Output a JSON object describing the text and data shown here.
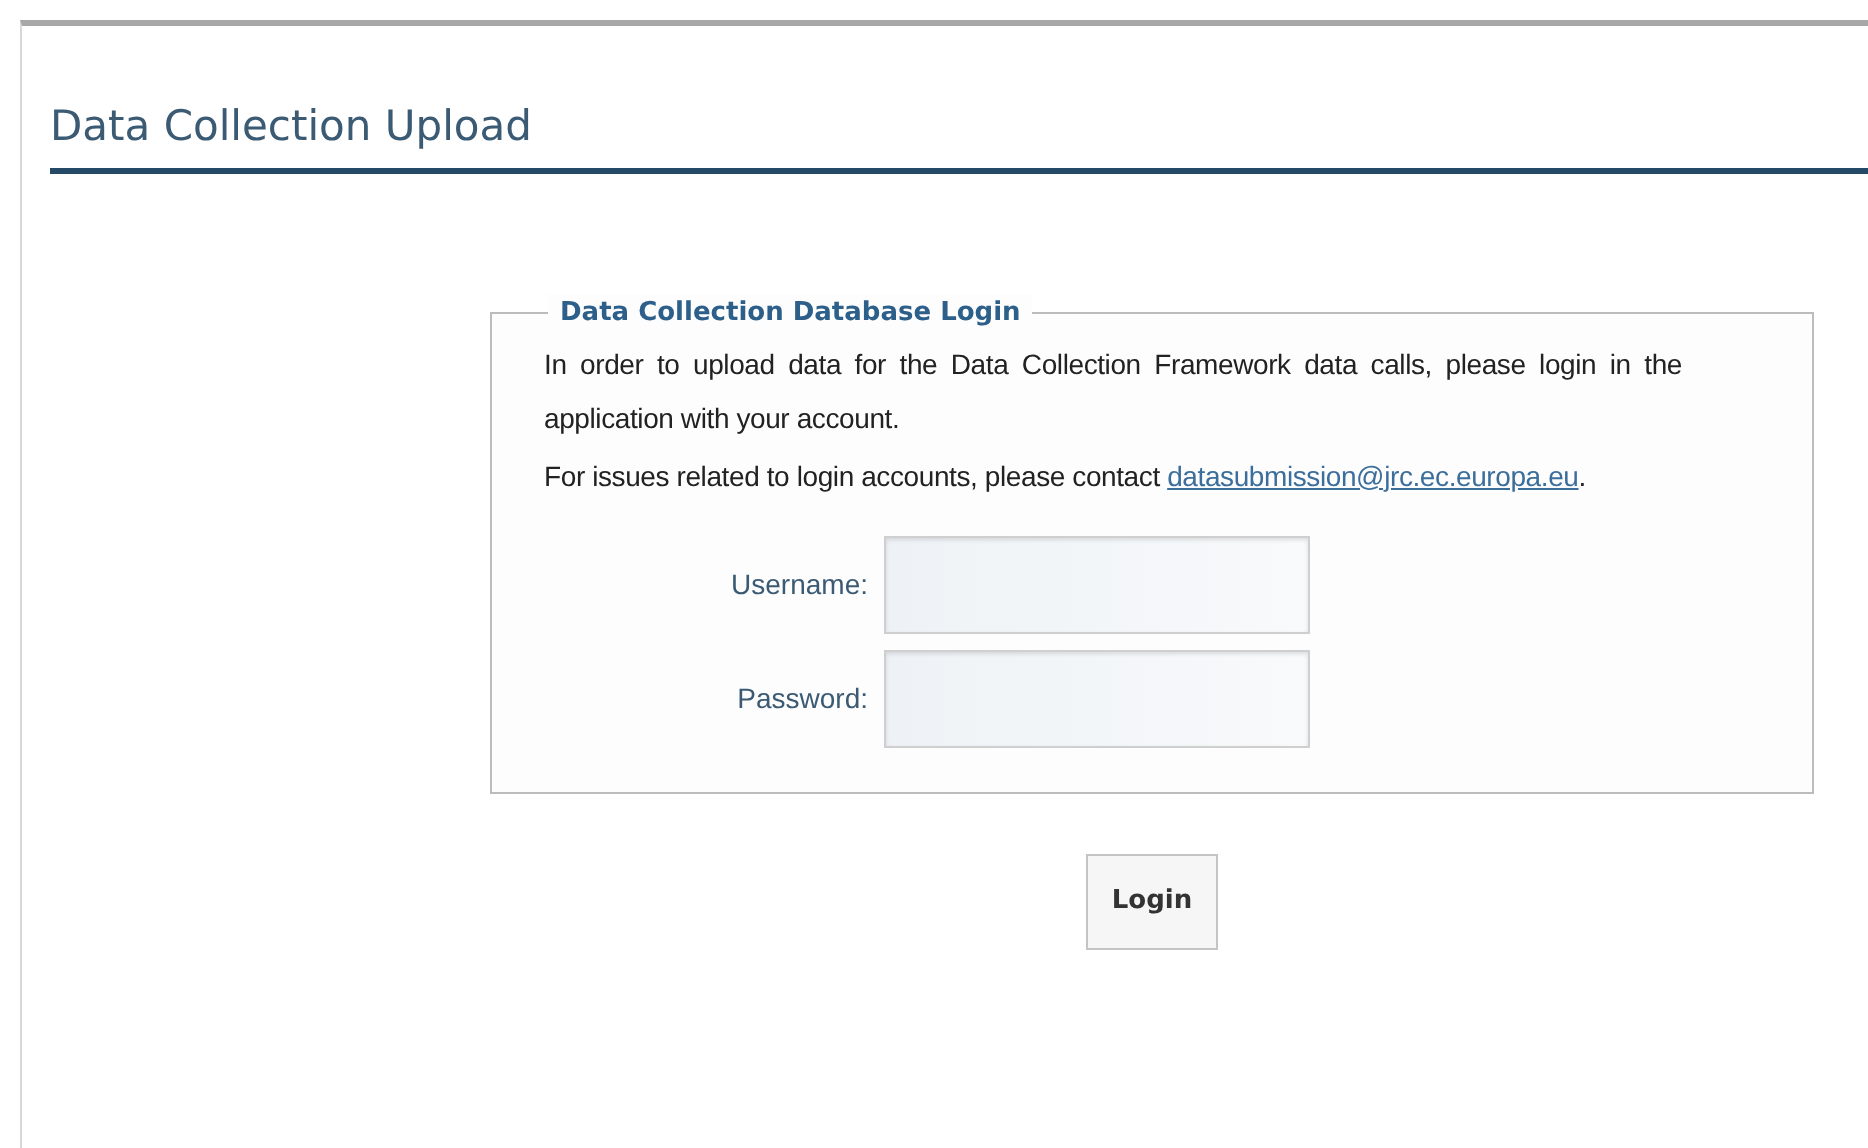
{
  "page": {
    "title": "Data Collection Upload"
  },
  "login_box": {
    "legend": "Data Collection Database Login",
    "paragraphs": [
      {
        "text": "In order to upload data for the Data Collection Framework data calls, please login in the application with your account."
      },
      {
        "text": "For issues related to login accounts, please contact ",
        "link": "datasubmission@jrc.ec.europa.eu",
        "after": "."
      }
    ],
    "fields": [
      {
        "label": "Username:"
      },
      {
        "label": "Password:"
      }
    ]
  },
  "buttons": [
    "Login"
  ]
}
